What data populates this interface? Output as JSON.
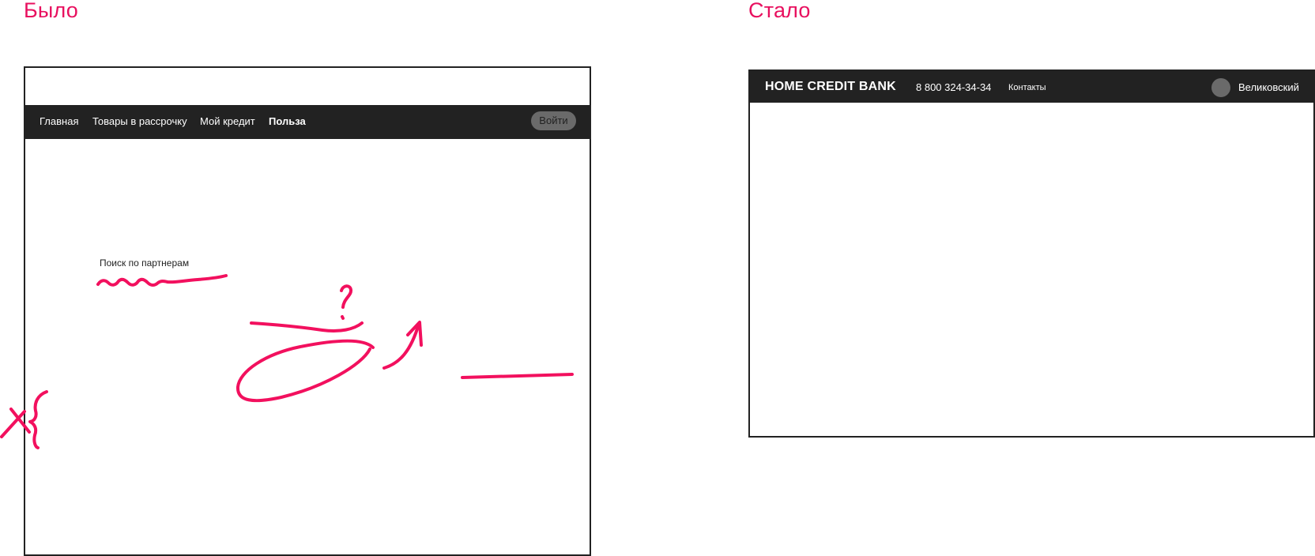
{
  "before": {
    "title": "Было",
    "nav": {
      "items": [
        {
          "label": "Главная"
        },
        {
          "label": "Товары в рассрочку"
        },
        {
          "label": "Мой кредит"
        },
        {
          "label": "Польза",
          "active": true
        }
      ],
      "login_label": "Войти"
    },
    "search_label": "Поиск по партнерам"
  },
  "after": {
    "title": "Стало",
    "nav": {
      "brand": "HOME CREDIT BANK",
      "phone": "8 800 324-34-34",
      "contacts_label": "Контакты",
      "user_name": "Великовский"
    }
  },
  "colors": {
    "accent": "#e8105f",
    "nav_background": "#222222",
    "frame_border": "#222222",
    "button_background": "#6a6a6a"
  },
  "icons": [
    "avatar-icon"
  ]
}
